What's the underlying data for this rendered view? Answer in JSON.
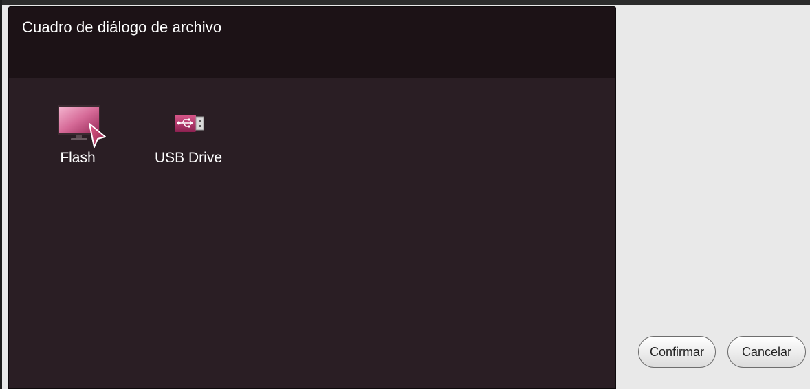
{
  "dialog": {
    "title": "Cuadro de diálogo de archivo"
  },
  "devices": [
    {
      "label": "Flash",
      "icon": "monitor-icon"
    },
    {
      "label": "USB Drive",
      "icon": "usb-drive-icon"
    }
  ],
  "buttons": {
    "confirm_label": "Confirmar",
    "cancel_label": "Cancelar"
  },
  "colors": {
    "dialog_background": "#2a1e24",
    "header_background": "#1c1216",
    "accent_pink": "#c0406e",
    "page_background": "#e9e9e9"
  }
}
